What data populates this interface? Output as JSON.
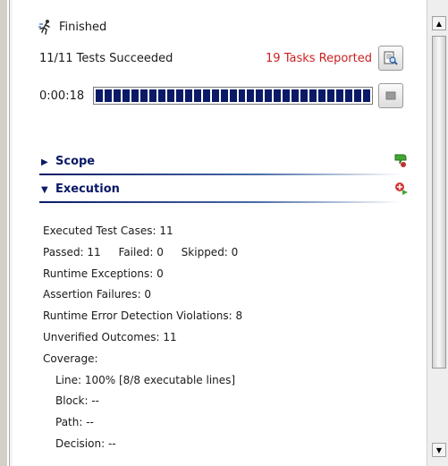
{
  "status": {
    "label": "Finished",
    "icon": "runner-icon"
  },
  "summary": {
    "tests": "11/11 Tests Succeeded",
    "tasks": "19 Tasks Reported",
    "tasks_color": "#cc1f1f"
  },
  "progress": {
    "elapsed": "0:00:18",
    "fraction": 1.0,
    "bar_color": "#0a1a66"
  },
  "sections": {
    "scope": {
      "title": "Scope",
      "expanded": false
    },
    "execution": {
      "title": "Execution",
      "expanded": true
    }
  },
  "stats": {
    "executed": "Executed Test Cases: 11",
    "passed": "Passed:  11",
    "failed": "Failed: 0",
    "skipped": "Skipped: 0",
    "runtime_exceptions": "Runtime Exceptions: 0",
    "assertion_failures": "Assertion Failures: 0",
    "red_violations": "Runtime Error Detection Violations: 8",
    "unverified": "Unverified Outcomes: 11",
    "coverage_label": "Coverage:",
    "line": "Line: 100% [8/8 executable lines]",
    "block": "Block: --",
    "path": "Path: --",
    "decision": "Decision: --"
  }
}
